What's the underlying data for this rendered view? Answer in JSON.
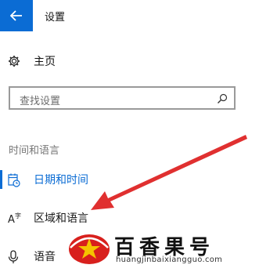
{
  "window": {
    "title": "设置",
    "back_icon": "arrow-left-icon",
    "accent_color": "#0b6cd4"
  },
  "home": {
    "label": "主页",
    "icon": "gear-icon"
  },
  "search": {
    "placeholder": "查找设置",
    "icon": "search-icon"
  },
  "group": {
    "label": "时间和语言"
  },
  "nav": [
    {
      "label": "日期和时间",
      "icon": "calendar-clock-icon",
      "selected": true
    },
    {
      "label": "区域和语言",
      "icon": "language-icon",
      "selected": false
    },
    {
      "label": "语音",
      "icon": "microphone-icon",
      "selected": false
    }
  ],
  "annotation": {
    "arrow_color": "#e03030"
  },
  "watermark": {
    "title": "百香果号",
    "url": "huangjinbaixiangguo.com",
    "logo_colors": [
      "#d8201d",
      "#f5c400"
    ]
  }
}
